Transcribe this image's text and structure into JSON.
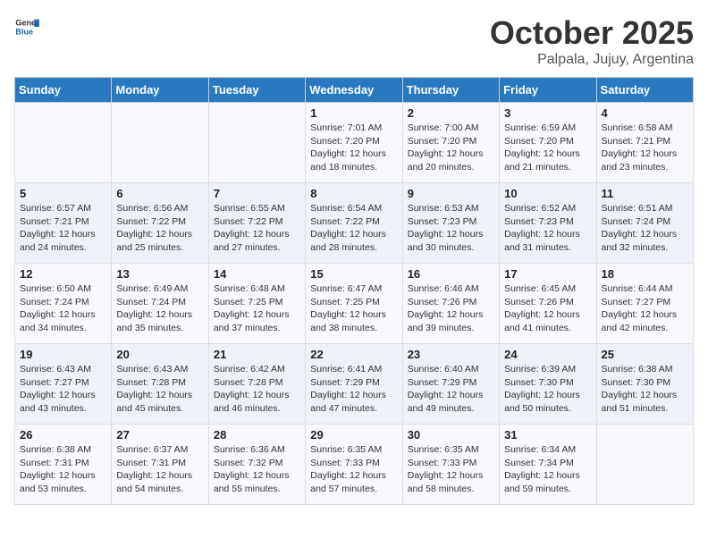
{
  "header": {
    "logo_general": "General",
    "logo_blue": "Blue",
    "month": "October 2025",
    "location": "Palpala, Jujuy, Argentina"
  },
  "weekdays": [
    "Sunday",
    "Monday",
    "Tuesday",
    "Wednesday",
    "Thursday",
    "Friday",
    "Saturday"
  ],
  "weeks": [
    [
      {
        "day": "",
        "text": ""
      },
      {
        "day": "",
        "text": ""
      },
      {
        "day": "",
        "text": ""
      },
      {
        "day": "1",
        "text": "Sunrise: 7:01 AM\nSunset: 7:20 PM\nDaylight: 12 hours\nand 18 minutes."
      },
      {
        "day": "2",
        "text": "Sunrise: 7:00 AM\nSunset: 7:20 PM\nDaylight: 12 hours\nand 20 minutes."
      },
      {
        "day": "3",
        "text": "Sunrise: 6:59 AM\nSunset: 7:20 PM\nDaylight: 12 hours\nand 21 minutes."
      },
      {
        "day": "4",
        "text": "Sunrise: 6:58 AM\nSunset: 7:21 PM\nDaylight: 12 hours\nand 23 minutes."
      }
    ],
    [
      {
        "day": "5",
        "text": "Sunrise: 6:57 AM\nSunset: 7:21 PM\nDaylight: 12 hours\nand 24 minutes."
      },
      {
        "day": "6",
        "text": "Sunrise: 6:56 AM\nSunset: 7:22 PM\nDaylight: 12 hours\nand 25 minutes."
      },
      {
        "day": "7",
        "text": "Sunrise: 6:55 AM\nSunset: 7:22 PM\nDaylight: 12 hours\nand 27 minutes."
      },
      {
        "day": "8",
        "text": "Sunrise: 6:54 AM\nSunset: 7:22 PM\nDaylight: 12 hours\nand 28 minutes."
      },
      {
        "day": "9",
        "text": "Sunrise: 6:53 AM\nSunset: 7:23 PM\nDaylight: 12 hours\nand 30 minutes."
      },
      {
        "day": "10",
        "text": "Sunrise: 6:52 AM\nSunset: 7:23 PM\nDaylight: 12 hours\nand 31 minutes."
      },
      {
        "day": "11",
        "text": "Sunrise: 6:51 AM\nSunset: 7:24 PM\nDaylight: 12 hours\nand 32 minutes."
      }
    ],
    [
      {
        "day": "12",
        "text": "Sunrise: 6:50 AM\nSunset: 7:24 PM\nDaylight: 12 hours\nand 34 minutes."
      },
      {
        "day": "13",
        "text": "Sunrise: 6:49 AM\nSunset: 7:24 PM\nDaylight: 12 hours\nand 35 minutes."
      },
      {
        "day": "14",
        "text": "Sunrise: 6:48 AM\nSunset: 7:25 PM\nDaylight: 12 hours\nand 37 minutes."
      },
      {
        "day": "15",
        "text": "Sunrise: 6:47 AM\nSunset: 7:25 PM\nDaylight: 12 hours\nand 38 minutes."
      },
      {
        "day": "16",
        "text": "Sunrise: 6:46 AM\nSunset: 7:26 PM\nDaylight: 12 hours\nand 39 minutes."
      },
      {
        "day": "17",
        "text": "Sunrise: 6:45 AM\nSunset: 7:26 PM\nDaylight: 12 hours\nand 41 minutes."
      },
      {
        "day": "18",
        "text": "Sunrise: 6:44 AM\nSunset: 7:27 PM\nDaylight: 12 hours\nand 42 minutes."
      }
    ],
    [
      {
        "day": "19",
        "text": "Sunrise: 6:43 AM\nSunset: 7:27 PM\nDaylight: 12 hours\nand 43 minutes."
      },
      {
        "day": "20",
        "text": "Sunrise: 6:43 AM\nSunset: 7:28 PM\nDaylight: 12 hours\nand 45 minutes."
      },
      {
        "day": "21",
        "text": "Sunrise: 6:42 AM\nSunset: 7:28 PM\nDaylight: 12 hours\nand 46 minutes."
      },
      {
        "day": "22",
        "text": "Sunrise: 6:41 AM\nSunset: 7:29 PM\nDaylight: 12 hours\nand 47 minutes."
      },
      {
        "day": "23",
        "text": "Sunrise: 6:40 AM\nSunset: 7:29 PM\nDaylight: 12 hours\nand 49 minutes."
      },
      {
        "day": "24",
        "text": "Sunrise: 6:39 AM\nSunset: 7:30 PM\nDaylight: 12 hours\nand 50 minutes."
      },
      {
        "day": "25",
        "text": "Sunrise: 6:38 AM\nSunset: 7:30 PM\nDaylight: 12 hours\nand 51 minutes."
      }
    ],
    [
      {
        "day": "26",
        "text": "Sunrise: 6:38 AM\nSunset: 7:31 PM\nDaylight: 12 hours\nand 53 minutes."
      },
      {
        "day": "27",
        "text": "Sunrise: 6:37 AM\nSunset: 7:31 PM\nDaylight: 12 hours\nand 54 minutes."
      },
      {
        "day": "28",
        "text": "Sunrise: 6:36 AM\nSunset: 7:32 PM\nDaylight: 12 hours\nand 55 minutes."
      },
      {
        "day": "29",
        "text": "Sunrise: 6:35 AM\nSunset: 7:33 PM\nDaylight: 12 hours\nand 57 minutes."
      },
      {
        "day": "30",
        "text": "Sunrise: 6:35 AM\nSunset: 7:33 PM\nDaylight: 12 hours\nand 58 minutes."
      },
      {
        "day": "31",
        "text": "Sunrise: 6:34 AM\nSunset: 7:34 PM\nDaylight: 12 hours\nand 59 minutes."
      },
      {
        "day": "",
        "text": ""
      }
    ]
  ]
}
